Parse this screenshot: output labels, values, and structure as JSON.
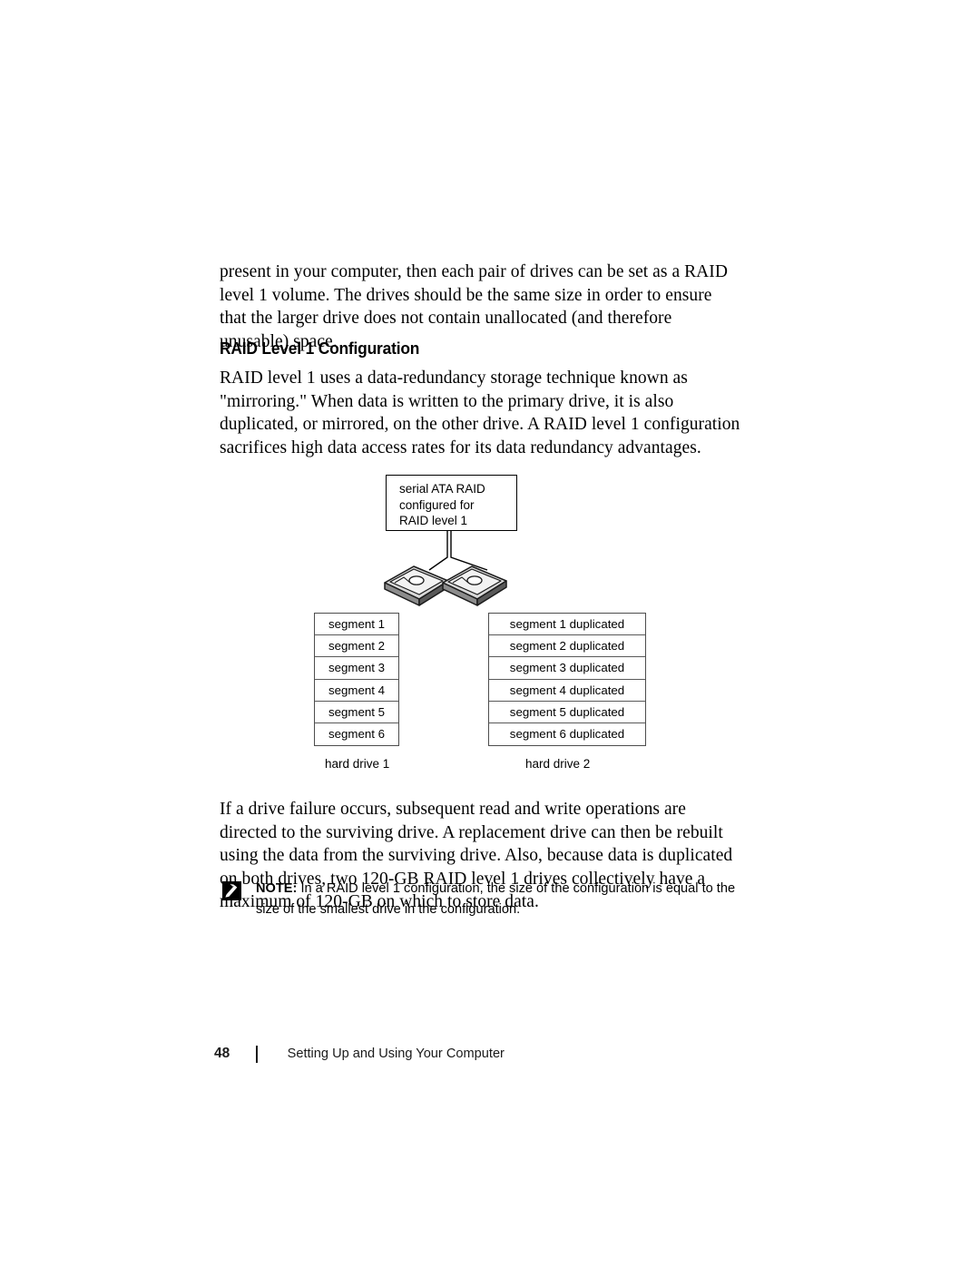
{
  "document": {
    "paragraphs": {
      "intro": "present in your computer, then each pair of drives can be set as a RAID level 1 volume. The drives should be the same size in order to ensure that the larger drive does not contain unallocated (and therefore unusable) space.",
      "mirroring": "RAID level 1 uses a data-redundancy storage technique known as \"mirroring.\" When data is written to the primary drive, it is also duplicated, or mirrored, on the other drive. A RAID level 1 configuration sacrifices high data access rates for its data redundancy advantages.",
      "failure": "If a drive failure occurs, subsequent read and write operations are directed to the surviving drive. A replacement drive can then be rebuilt using the data from the surviving drive. Also, because data is duplicated on both drives, two 120-GB RAID level 1 drives collectively have a maximum of 120-GB on which to store data."
    },
    "heading": "RAID Level 1 Configuration",
    "figure": {
      "callout": {
        "line1": "serial ATA RAID",
        "line2": "configured for",
        "line3": "RAID level 1"
      },
      "drive_icon_1_name": "hard-drive-icon",
      "drive_icon_2_name": "hard-drive-icon",
      "left_table": {
        "rows": [
          "segment 1",
          "segment 2",
          "segment 3",
          "segment 4",
          "segment 5",
          "segment 6"
        ],
        "label": "hard drive 1"
      },
      "right_table": {
        "rows": [
          "segment 1 duplicated",
          "segment 2 duplicated",
          "segment 3 duplicated",
          "segment 4 duplicated",
          "segment 5 duplicated",
          "segment 6 duplicated"
        ],
        "label": "hard drive 2"
      }
    },
    "note": {
      "icon": "note-pencil-icon",
      "label": "NOTE:",
      "text": " In a RAID level 1 configuration, the size of the configuration is equal to the size of the smallest drive in the configuration."
    },
    "footer": {
      "page_number": "48",
      "title": "Setting Up and Using Your Computer"
    }
  },
  "colors": {
    "text": "#000000",
    "table_border": "#4d4d4d",
    "note_icon_bg": "#000000",
    "footer_text": "#1a1a1a"
  }
}
